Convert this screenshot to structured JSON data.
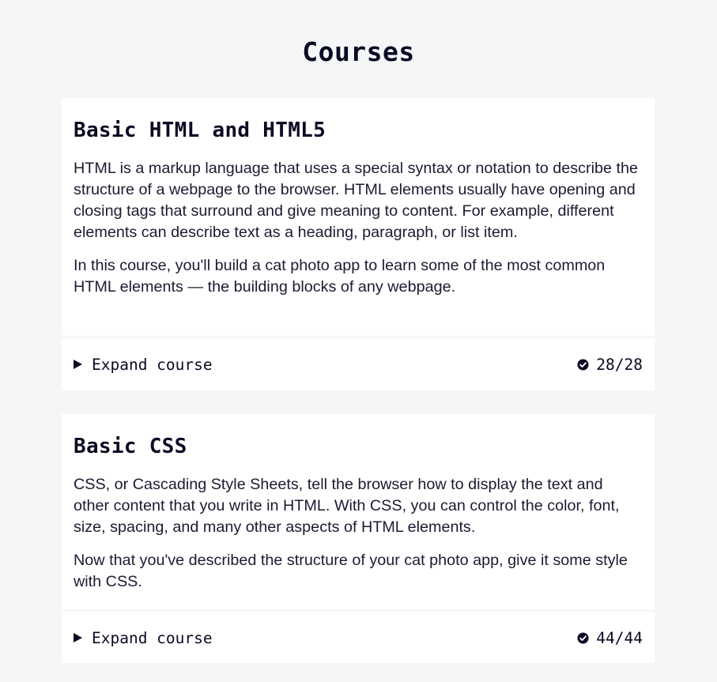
{
  "page": {
    "title": "Courses"
  },
  "courses": [
    {
      "title": "Basic HTML and HTML5",
      "paragraphs": [
        "HTML is a markup language that uses a special syntax or notation to describe the structure of a webpage to the browser. HTML elements usually have opening and closing tags that surround and give meaning to content. For example, different elements can describe text as a heading, paragraph, or list item.",
        "In this course, you'll build a cat photo app to learn some of the most common HTML elements — the building blocks of any webpage."
      ],
      "expand_label": "Expand course",
      "progress": "28/28",
      "toggle_icon": "triangle-right-icon",
      "status_icon": "check-circle-icon"
    },
    {
      "title": "Basic CSS",
      "paragraphs": [
        "CSS, or Cascading Style Sheets, tell the browser how to display the text and other content that you write in HTML. With CSS, you can control the color, font, size, spacing, and many other aspects of HTML elements.",
        "Now that you've described the structure of your cat photo app, give it some style with CSS."
      ],
      "expand_label": "Expand course",
      "progress": "44/44",
      "toggle_icon": "triangle-right-icon",
      "status_icon": "check-circle-icon"
    }
  ],
  "colors": {
    "background": "#f5f6f7",
    "card": "#ffffff",
    "text": "#0a0a23"
  }
}
